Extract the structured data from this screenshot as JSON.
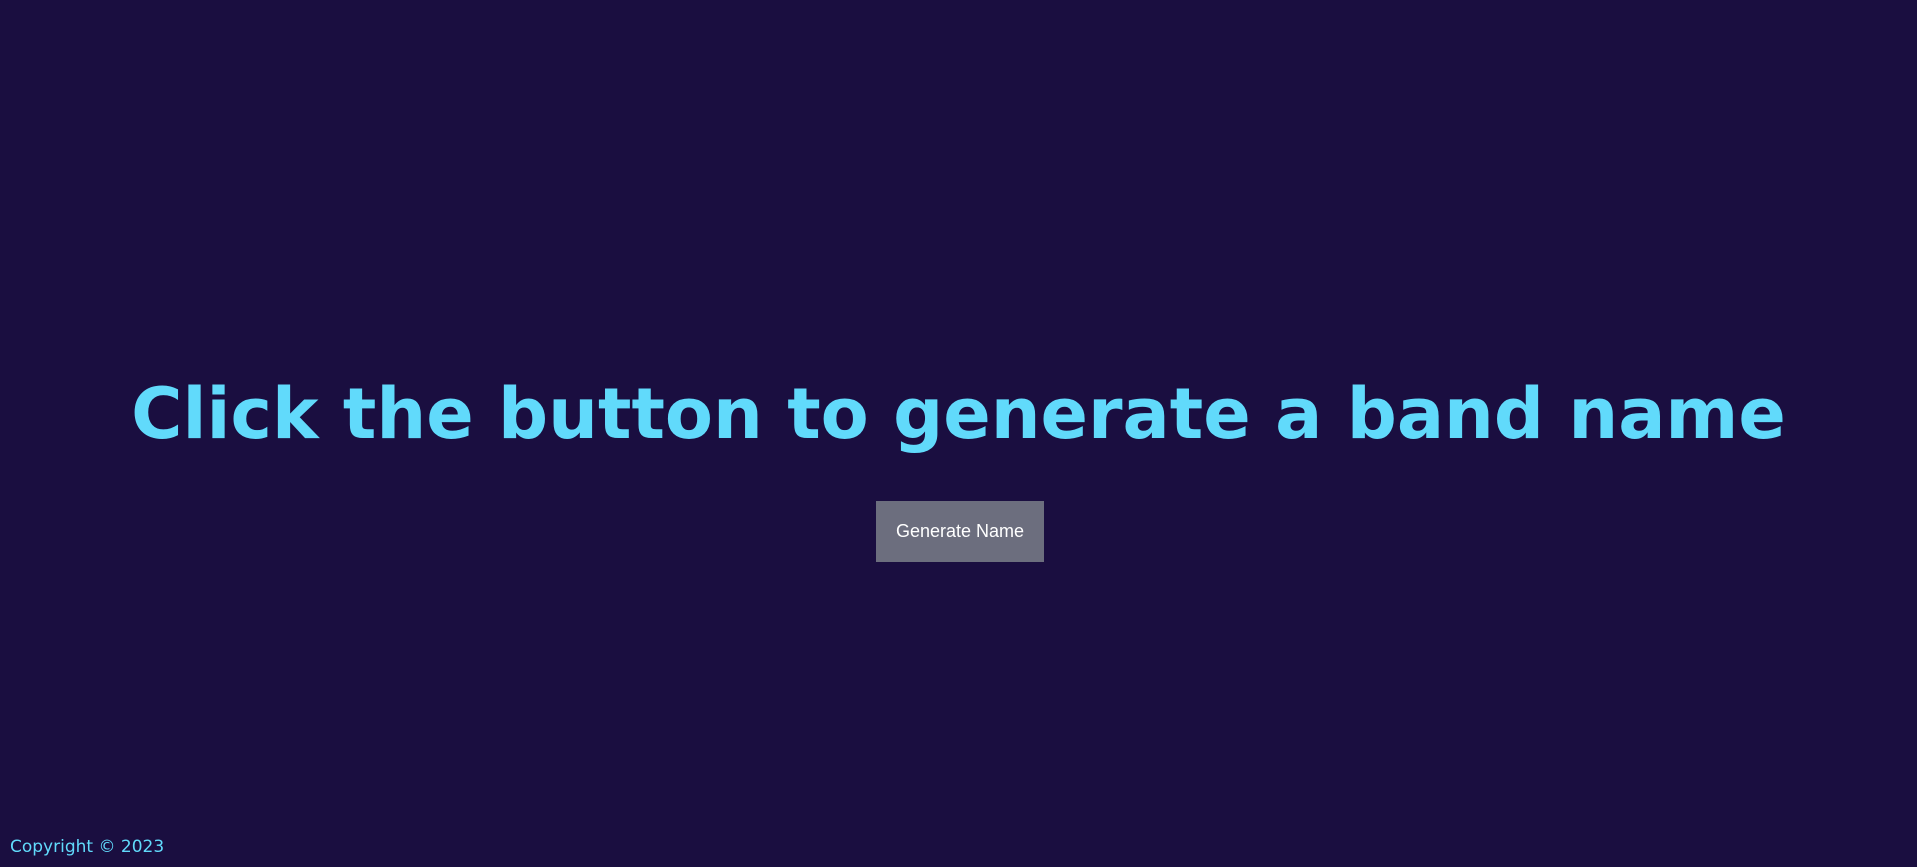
{
  "main": {
    "headline": "Click the button to generate a band name",
    "generate_button_label": "Generate Name"
  },
  "footer": {
    "copyright": "Copyright © 2023"
  },
  "colors": {
    "background": "#1a0e40",
    "accent_text": "#61dafb",
    "button_background": "#6c6e7e",
    "button_text": "#ffffff"
  }
}
